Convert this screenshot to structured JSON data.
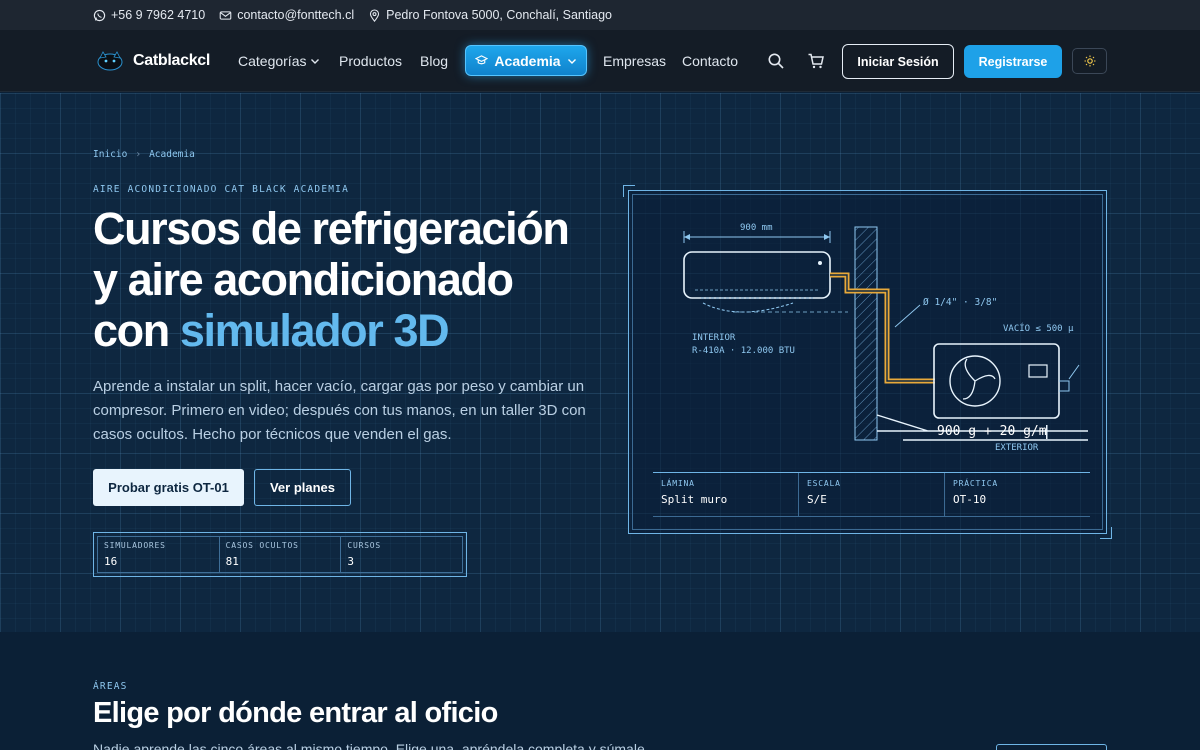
{
  "topbar": {
    "phone": "+56 9 7962 4710",
    "email": "contacto@fonttech.cl",
    "address": "Pedro Fontova 5000, Conchalí, Santiago"
  },
  "nav": {
    "logo_text": "Catblackcl",
    "links": [
      "Categorías",
      "Productos",
      "Blog",
      "Academia",
      "Empresas",
      "Contacto"
    ],
    "login_label": "Iniciar Sesión",
    "register_label": "Registrarse",
    "icons": [
      "search-icon",
      "cart-icon",
      "sun-icon",
      "chevron-down-icon",
      "graduation-cap-icon"
    ]
  },
  "hero": {
    "breadcrumb": [
      "Inicio",
      "Academia"
    ],
    "eyebrow": "AIRE ACONDICIONADO CAT BLACK ACADEMIA",
    "title_lines": [
      "Cursos de refrigeración",
      "y aire acondicionado",
      "con "
    ],
    "title_accent": "simulador 3D",
    "description": "Aprende a instalar un split, hacer vacío, cargar gas por peso y cambiar un compresor. Primero en video; después con tus manos, en un taller 3D con casos ocultos. Hecho por técnicos que venden el gas.",
    "primary_cta": "Probar gratis OT-01",
    "secondary_cta": "Ver planes",
    "stats": [
      {
        "label": "SIMULADORES",
        "value": "16"
      },
      {
        "label": "CASOS OCULTOS",
        "value": "81"
      },
      {
        "label": "CURSOS",
        "value": "3"
      }
    ]
  },
  "blueprint": {
    "dimension": "900 mm",
    "pipe_label": "Ø 1/4\" · 3/8\"",
    "vacuum_label": "VACÍO ≤ 500 µ",
    "interior_label": "INTERIOR",
    "interior_spec": "R-410A · 12.000 BTU",
    "charge_label": "900 g + 20 g/m",
    "exterior_label": "EXTERIOR",
    "titleblock": [
      {
        "label": "LÁMINA",
        "value": "Split muro"
      },
      {
        "label": "ESCALA",
        "value": "S/E"
      },
      {
        "label": "PRÁCTICA",
        "value": "OT-10"
      }
    ],
    "colors": {
      "line": "#8fc8f0",
      "pipe": "#e8a93a"
    }
  },
  "areas": {
    "eyebrow": "ÁREAS",
    "title": "Elige por dónde entrar al oficio",
    "description": "Nadie aprende las cinco áreas al mismo tiempo. Elige una, apréndela completa y súmale"
  },
  "colors": {
    "accent": "#1ea1e8",
    "accent_text": "#63b9ee",
    "bg": "#0e2740"
  }
}
